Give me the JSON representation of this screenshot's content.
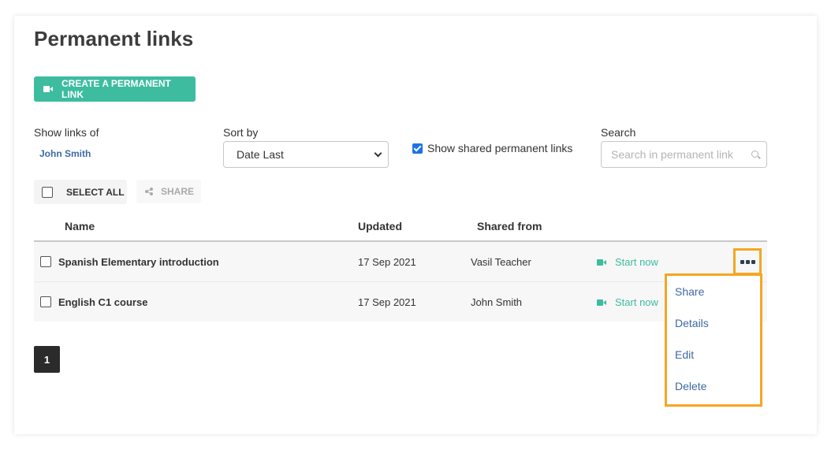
{
  "page": {
    "title": "Permanent links",
    "create_button": {
      "label": "CREATE A PERMANENT LINK",
      "icon": "video-camera-icon"
    }
  },
  "filters": {
    "show_links_of_label": "Show links of",
    "show_links_of_value": "John Smith",
    "sort_by_label": "Sort by",
    "sort_by_value": "Date Last",
    "show_shared_label": "Show shared permanent links",
    "show_shared_checked": true,
    "search_label": "Search",
    "search_placeholder": "Search in permanent link",
    "search_value": ""
  },
  "toolbar": {
    "select_all_label": "SELECT ALL",
    "share_label": "SHARE"
  },
  "table": {
    "columns": [
      "Name",
      "Updated",
      "Shared from"
    ],
    "rows": [
      {
        "name": "Spanish Elementary introduction",
        "updated": "17 Sep 2021",
        "shared_from": "Vasil Teacher",
        "action": "Start now",
        "checked": false
      },
      {
        "name": "English C1 course",
        "updated": "17 Sep 2021",
        "shared_from": "John Smith",
        "action": "Start now",
        "checked": false
      }
    ]
  },
  "context_menu": {
    "items": [
      "Share",
      "Details",
      "Edit",
      "Delete"
    ],
    "highlight_color": "#f5a623"
  },
  "pagination": {
    "current_page": "1"
  },
  "colors": {
    "accent": "#3dbca0",
    "link": "#3e6aa3",
    "highlight": "#f5a623"
  }
}
